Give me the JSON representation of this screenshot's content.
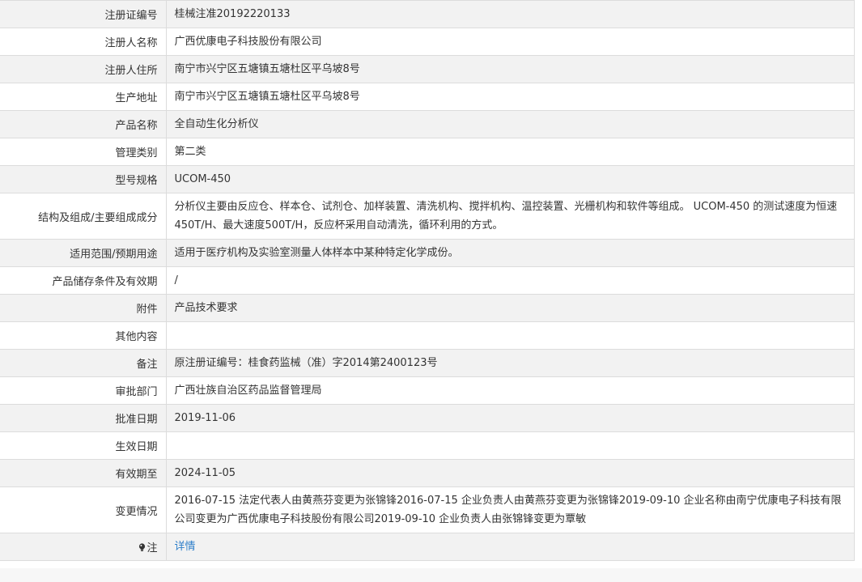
{
  "rows": [
    {
      "label": "注册证编号",
      "value": "桂械注准20192220133"
    },
    {
      "label": "注册人名称",
      "value": "广西优康电子科技股份有限公司"
    },
    {
      "label": "注册人住所",
      "value": "南宁市兴宁区五塘镇五塘杜区平乌坡8号"
    },
    {
      "label": "生产地址",
      "value": "南宁市兴宁区五塘镇五塘杜区平乌坡8号"
    },
    {
      "label": "产品名称",
      "value": "全自动生化分析仪"
    },
    {
      "label": "管理类别",
      "value": "第二类"
    },
    {
      "label": "型号规格",
      "value": "UCOM-450"
    },
    {
      "label": "结构及组成/主要组成成分",
      "value": "分析仪主要由反应仓、样本仓、试剂仓、加样装置、清洗机构、搅拌机构、温控装置、光栅机构和软件等组成。 UCOM-450 的测试速度为恒速450T/H、最大速度500T/H，反应杯采用自动清洗，循环利用的方式。"
    },
    {
      "label": "适用范围/预期用途",
      "value": "适用于医疗机构及实验室测量人体样本中某种特定化学成份。"
    },
    {
      "label": "产品储存条件及有效期",
      "value": "/"
    },
    {
      "label": "附件",
      "value": "产品技术要求"
    },
    {
      "label": "其他内容",
      "value": ""
    },
    {
      "label": "备注",
      "value": "原注册证编号：桂食药监械（准）字2014第2400123号"
    },
    {
      "label": "审批部门",
      "value": "广西壮族自治区药品监督管理局"
    },
    {
      "label": "批准日期",
      "value": "2019-11-06"
    },
    {
      "label": "生效日期",
      "value": ""
    },
    {
      "label": "有效期至",
      "value": "2024-11-05"
    },
    {
      "label": "变更情况",
      "value": "2016-07-15 法定代表人由黄燕芬变更为张锦锋2016-07-15 企业负责人由黄燕芬变更为张锦锋2019-09-10 企业名称由南宁优康电子科技有限公司变更为广西优康电子科技股份有限公司2019-09-10 企业负责人由张锦锋变更为覃敏"
    }
  ],
  "note": {
    "label": "注",
    "icon": "lightbulb-icon",
    "link_text": "详情",
    "link_color": "#2d7ec9"
  },
  "colors": {
    "row_alt": "#f2f2f2",
    "border": "#dcdcdc",
    "text": "#333333"
  }
}
